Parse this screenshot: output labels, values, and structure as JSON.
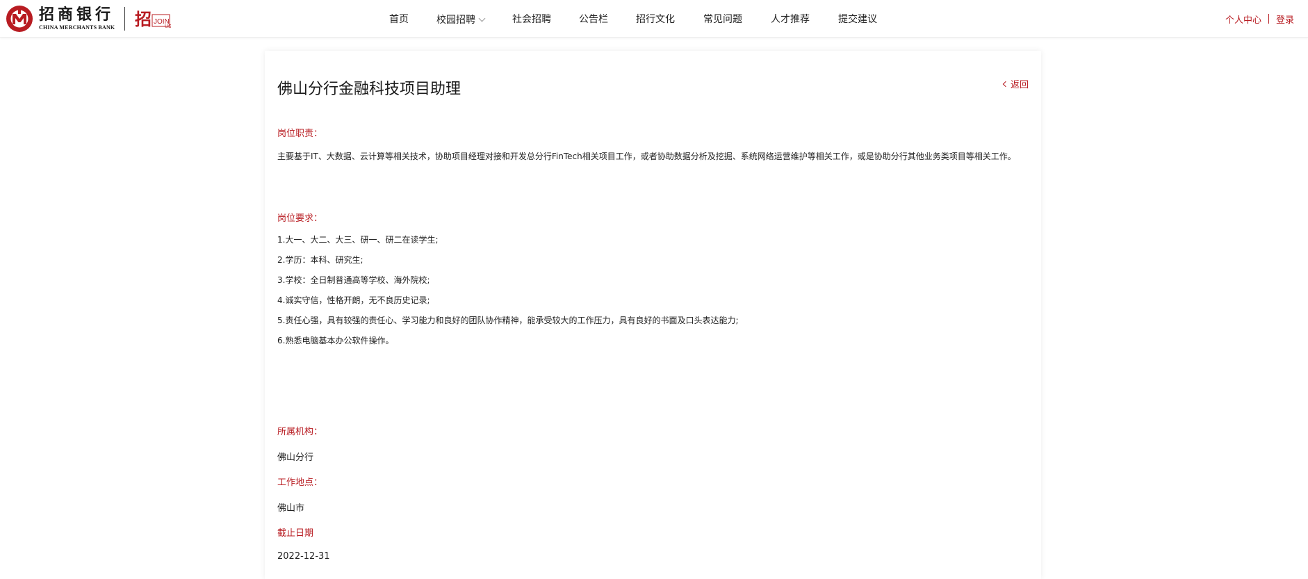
{
  "header": {
    "brand_cn": "招商银行",
    "brand_en": "CHINA MERCHANTS BANK",
    "join_logo_text": "招 JOIN US",
    "nav": [
      {
        "label": "首页",
        "has_dropdown": false
      },
      {
        "label": "校园招聘",
        "has_dropdown": true
      },
      {
        "label": "社会招聘",
        "has_dropdown": false
      },
      {
        "label": "公告栏",
        "has_dropdown": false
      },
      {
        "label": "招行文化",
        "has_dropdown": false
      },
      {
        "label": "常见问题",
        "has_dropdown": false
      },
      {
        "label": "人才推荐",
        "has_dropdown": false
      },
      {
        "label": "提交建议",
        "has_dropdown": false
      }
    ],
    "user_center": "个人中心",
    "login": "登录"
  },
  "job": {
    "title": "佛山分行金融科技项目助理",
    "back_label": "返回",
    "duties_label": "岗位职责：",
    "duties_text": "主要基于IT、大数据、云计算等相关技术，协助项目经理对接和开发总分行FinTech相关项目工作，或者协助数据分析及挖掘、系统网络运营维护等相关工作，或是协助分行其他业务类项目等相关工作。",
    "requirements_label": "岗位要求：",
    "requirements": [
      "1.大一、大二、大三、研一、研二在读学生;",
      "2.学历：本科、研究生;",
      "3.学校：全日制普通高等学校、海外院校;",
      "4.诚实守信，性格开朗，无不良历史记录;",
      "5.责任心强，具有较强的责任心、学习能力和良好的团队协作精神，能承受较大的工作压力，具有良好的书面及口头表达能力;",
      "6.熟悉电脑基本办公软件操作。"
    ],
    "org_label": "所属机构：",
    "org_value": "佛山分行",
    "location_label": "工作地点：",
    "location_value": "佛山市",
    "deadline_label": "截止日期",
    "deadline_value": "2022-12-31"
  },
  "colors": {
    "brand_red": "#b81c22",
    "text": "#222222"
  },
  "icons": {
    "bank_logo": "cmb-logo-icon",
    "back": "chevron-left-icon",
    "dropdown": "chevron-down-icon"
  }
}
